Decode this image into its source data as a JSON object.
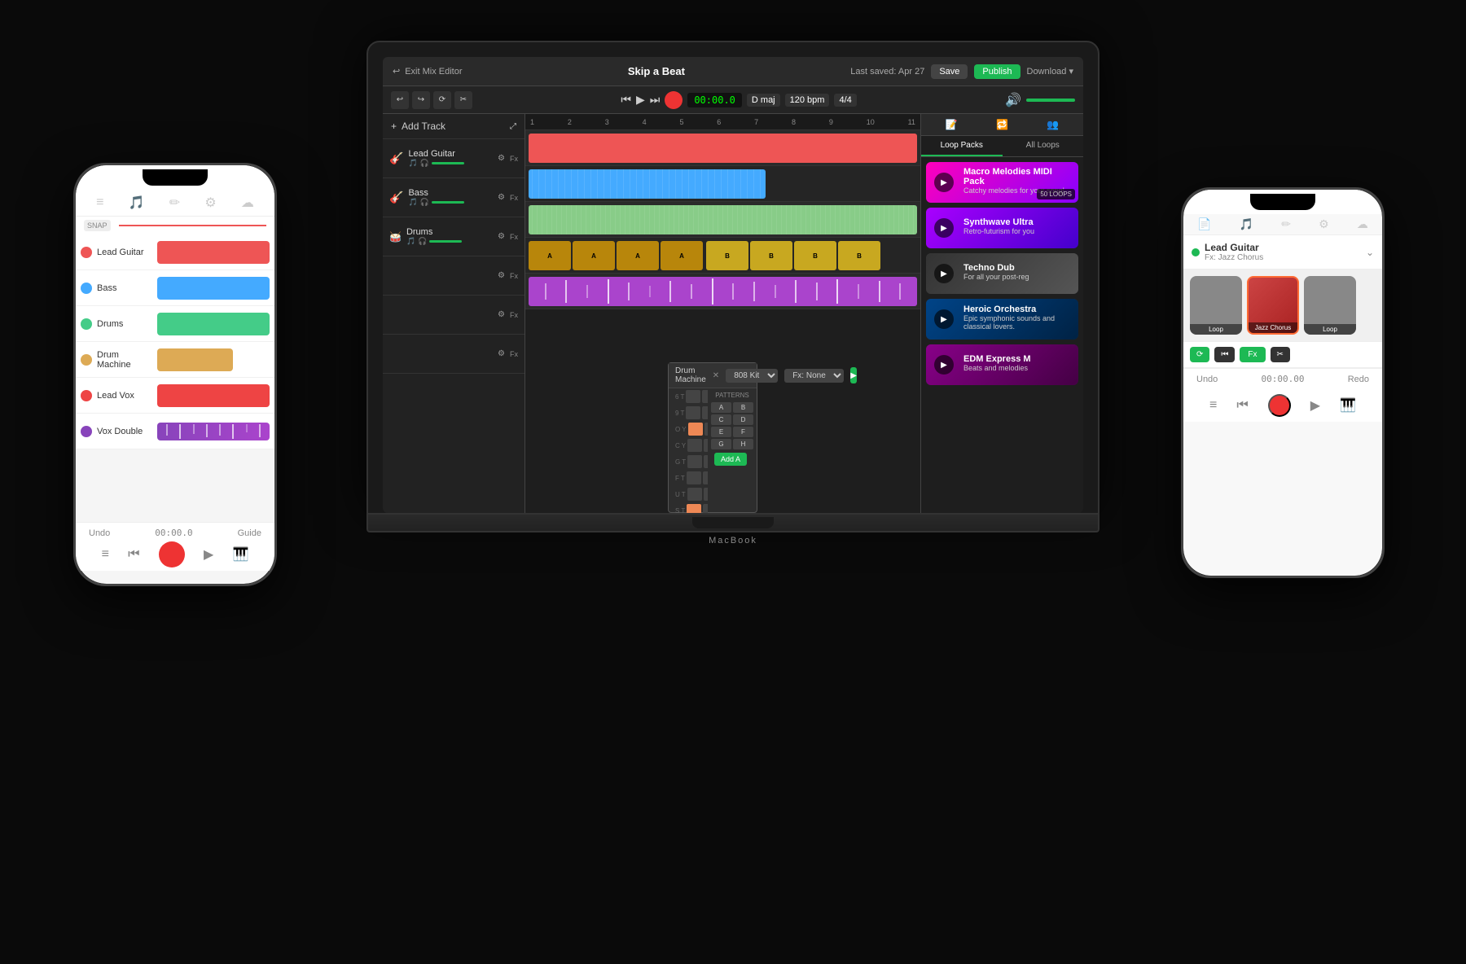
{
  "app": {
    "title": "Skip a Beat",
    "last_saved": "Last saved: Apr 27",
    "save_label": "Save",
    "publish_label": "Publish",
    "download_label": "Download ▾",
    "exit_label": "Exit Mix Editor",
    "macbook_label": "MacBook"
  },
  "toolbar": {
    "time": "00:00.0",
    "key": "D maj",
    "bpm": "120 bpm",
    "time_sig": "4/4"
  },
  "tracks": [
    {
      "name": "Lead Guitar",
      "color": "#e55",
      "icon_color": "#e55"
    },
    {
      "name": "Bass",
      "color": "#4af",
      "icon_color": "#4af"
    },
    {
      "name": "Drums",
      "color": "#8c8",
      "icon_color": "#8c8"
    },
    {
      "name": "Drum Machine",
      "color": "#da5",
      "icon_color": "#da5"
    },
    {
      "name": "Lead Vox",
      "color": "#e66",
      "icon_color": "#e66"
    },
    {
      "name": "Vox Double",
      "color": "#a4c",
      "icon_color": "#a4c"
    }
  ],
  "add_track_label": "Add Track",
  "right_panel": {
    "tab1": "Loop Packs",
    "tab2": "All Loops",
    "loops": [
      {
        "title": "Macro Melodies MIDI Pack",
        "sub": "Catchy melodies for your song!",
        "badge": "50 LOOPS"
      },
      {
        "title": "Synthwave Ultra",
        "sub": "Retro-futurism for you"
      },
      {
        "title": "Techno Dub",
        "sub": "For all your post-reg"
      },
      {
        "title": "Heroic Orchestra",
        "sub": "Epic symphonic sounds and classical lovers."
      },
      {
        "title": "EDM Express M",
        "sub": "Beats and melodies"
      }
    ]
  },
  "drum_machine": {
    "title": "Drum Machine",
    "kit": "808 Kit",
    "fx": "Fx: None",
    "add_label": "Add A",
    "patterns_label": "PATTERNS",
    "pattern_buttons": [
      "A",
      "B",
      "C",
      "D",
      "E",
      "F",
      "G",
      "H"
    ],
    "rows": [
      {
        "inst": "6",
        "vol": "T"
      },
      {
        "inst": "9",
        "vol": "T"
      },
      {
        "inst": "O",
        "vol": "Y"
      },
      {
        "inst": "C",
        "vol": "Y"
      },
      {
        "inst": "G",
        "vol": "T"
      },
      {
        "inst": "F",
        "vol": "T"
      },
      {
        "inst": "U",
        "vol": "T"
      },
      {
        "inst": "S",
        "vol": "T"
      }
    ]
  },
  "phone_left": {
    "tracks": [
      {
        "name": "Lead Guitar",
        "color": "#e55"
      },
      {
        "name": "Bass",
        "color": "#4af"
      },
      {
        "name": "Drums",
        "color": "#4c8"
      },
      {
        "name": "Drum Machine",
        "color": "#da5"
      },
      {
        "name": "Lead Vox",
        "color": "#e44"
      },
      {
        "name": "Vox Double",
        "color": "#84b"
      }
    ],
    "time": "00:00.0",
    "undo_label": "Undo",
    "redo_label": "Guide"
  },
  "phone_right": {
    "track_name": "Lead Guitar",
    "track_fx": "Fx: Jazz Chorus",
    "fx_cards": [
      {
        "label": "Loop"
      },
      {
        "label": "Jazz Chorus"
      },
      {
        "label": "Loop"
      }
    ],
    "undo_label": "Undo",
    "time": "00:00.00",
    "redo_label": "Redo"
  }
}
